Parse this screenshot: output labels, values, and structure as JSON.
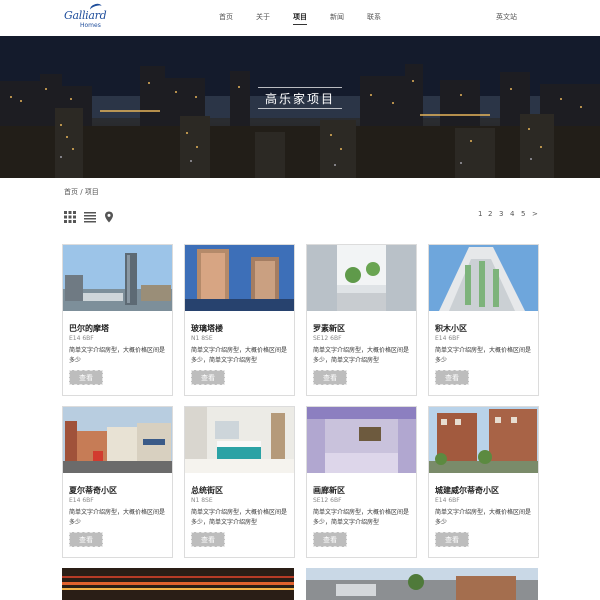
{
  "brand": {
    "logo_line1": "Galliard",
    "logo_line2": "Homes"
  },
  "nav": {
    "items": [
      {
        "label": "首页"
      },
      {
        "label": "关于"
      },
      {
        "label": "项目"
      },
      {
        "label": "新闻"
      },
      {
        "label": "联系"
      }
    ],
    "language": "英文站"
  },
  "banner": {
    "title": "高乐家项目"
  },
  "breadcrumb": "首页 / 项目",
  "toolbar": {
    "views": [
      "grid-view-icon",
      "list-view-icon",
      "map-view-icon"
    ]
  },
  "pagination": {
    "pages": [
      "1",
      "2",
      "3",
      "4",
      "5"
    ],
    "next": ">"
  },
  "projects": [
    {
      "name": "巴尔的摩塔",
      "code": "E14 6BF",
      "desc": "简单文字介绍房型，大概价格区间是多少",
      "button": "查看"
    },
    {
      "name": "玻璃塔楼",
      "code": "N1 8SE",
      "desc": "简单文字介绍房型，大概价格区间是多少，简单文字介绍房型",
      "button": "查看"
    },
    {
      "name": "罗素新区",
      "code": "SE12 6BF",
      "desc": "简单文字介绍房型，大概价格区间是多少，简单文字介绍房型",
      "button": "查看"
    },
    {
      "name": "积木小区",
      "code": "E14 6BF",
      "desc": "简单文字介绍房型，大概价格区间是多少",
      "button": "查看"
    },
    {
      "name": "夏尔蒂奇小区",
      "code": "E14 6BF",
      "desc": "简单文字介绍房型，大概价格区间是多少",
      "button": "查看"
    },
    {
      "name": "总统街区",
      "code": "N1 8SE",
      "desc": "简单文字介绍房型，大概价格区间是多少，简单文字介绍房型",
      "button": "查看"
    },
    {
      "name": "画廊新区",
      "code": "SE12 6BF",
      "desc": "简单文字介绍房型，大概价格区间是多少，简单文字介绍房型",
      "button": "查看"
    },
    {
      "name": "城建威尔蒂奇小区",
      "code": "E14 6BF",
      "desc": "简单文字介绍房型，大概价格区间是多少",
      "button": "查看"
    }
  ],
  "colors": {
    "brand_blue": "#1f4e9c",
    "button_gray": "#bdbdbd",
    "card_border": "#dcdcdc"
  }
}
